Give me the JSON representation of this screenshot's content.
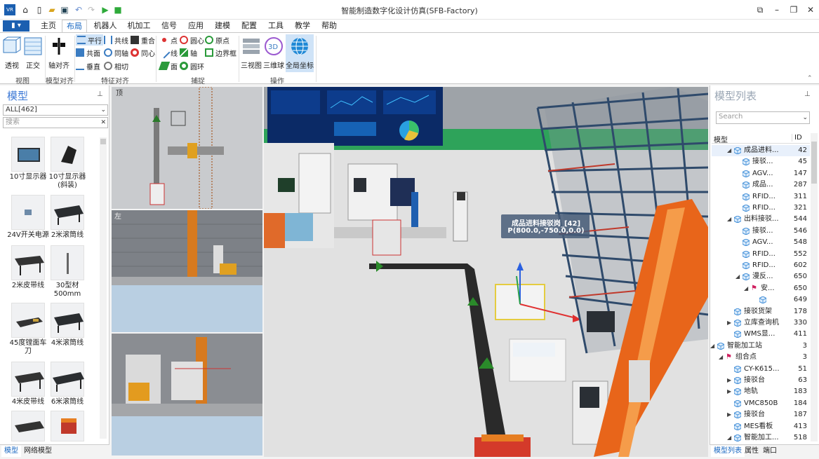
{
  "app": {
    "title": "智能制造数字化设计仿真(SFB-Factory)"
  },
  "menu": {
    "file_label": "▮ ▾",
    "tabs": [
      "主页",
      "布局",
      "机器人",
      "机加工",
      "信号",
      "应用",
      "建模",
      "配置",
      "工具",
      "教学",
      "帮助"
    ],
    "active": "布局"
  },
  "ribbon": {
    "view_group": {
      "label": "视图",
      "perspective": "透视",
      "ortho": "正交"
    },
    "axis_group": {
      "label": "模型对齐",
      "axis_align": "轴对齐"
    },
    "feature_group": {
      "label": "特征对齐",
      "items": [
        "平行",
        "共线",
        "重合",
        "共面",
        "同轴",
        "同心",
        "垂直",
        "相切"
      ]
    },
    "capture_group": {
      "label": "捕捉",
      "items": [
        "点",
        "圆心",
        "原点",
        "线",
        "轴",
        "边界框",
        "面",
        "圆环"
      ]
    },
    "op_group": {
      "label": "操作",
      "three_view": "三视图",
      "sphere": "三维球",
      "global": "全局坐标"
    }
  },
  "left_panel": {
    "title": "模型",
    "filter_value": "ALL[462]",
    "search_placeholder": "搜索",
    "items": [
      "10寸显示器",
      "10寸显示器(斜装)",
      "24V开关电源",
      "2米滚筒线",
      "2米皮带线",
      "30型材500mm",
      "45度镗面车刀",
      "4米滚筒线",
      "4米皮带线",
      "6米滚筒线"
    ],
    "tabs": [
      "模型",
      "网络模型"
    ]
  },
  "viewports": {
    "top_label": "顶",
    "left_label": "左"
  },
  "scene": {
    "tooltip_name": "成品进料接驳岗_[42]",
    "tooltip_pos": "P(800.0,-750.0,0.0)"
  },
  "right_panel": {
    "title": "模型列表",
    "search_placeholder": "Search",
    "col_model": "模型",
    "col_id": "ID",
    "rows": [
      {
        "name": "成品进料...",
        "id": "42"
      },
      {
        "name": "接驳...",
        "id": "45"
      },
      {
        "name": "AGV...",
        "id": "147"
      },
      {
        "name": "成品...",
        "id": "287"
      },
      {
        "name": "RFID...",
        "id": "311"
      },
      {
        "name": "RFID...",
        "id": "321"
      },
      {
        "name": "出料接驳...",
        "id": "544"
      },
      {
        "name": "接驳...",
        "id": "546"
      },
      {
        "name": "AGV...",
        "id": "548"
      },
      {
        "name": "RFID...",
        "id": "552"
      },
      {
        "name": "RFID...",
        "id": "602"
      },
      {
        "name": "漫反...",
        "id": "650"
      },
      {
        "name": "安...",
        "id": "650"
      },
      {
        "name": "",
        "id": "649"
      },
      {
        "name": "接驳货架",
        "id": "178"
      },
      {
        "name": "立库查询机",
        "id": "330"
      },
      {
        "name": "WMS显...",
        "id": "411"
      },
      {
        "name": "智能加工站",
        "id": "3"
      },
      {
        "name": "组合点",
        "id": "3"
      },
      {
        "name": "CY-K615...",
        "id": "51"
      },
      {
        "name": "接驳台",
        "id": "63"
      },
      {
        "name": "地轨",
        "id": "183"
      },
      {
        "name": "VMC850B",
        "id": "184"
      },
      {
        "name": "接驳台",
        "id": "187"
      },
      {
        "name": "MES看板",
        "id": "413"
      },
      {
        "name": "智能加工...",
        "id": "518"
      }
    ],
    "tabs": [
      "模型列表",
      "属性",
      "端口"
    ]
  },
  "colors": {
    "accent": "#1565c0",
    "orange": "#e8651a",
    "rack": "#3d5f86"
  }
}
